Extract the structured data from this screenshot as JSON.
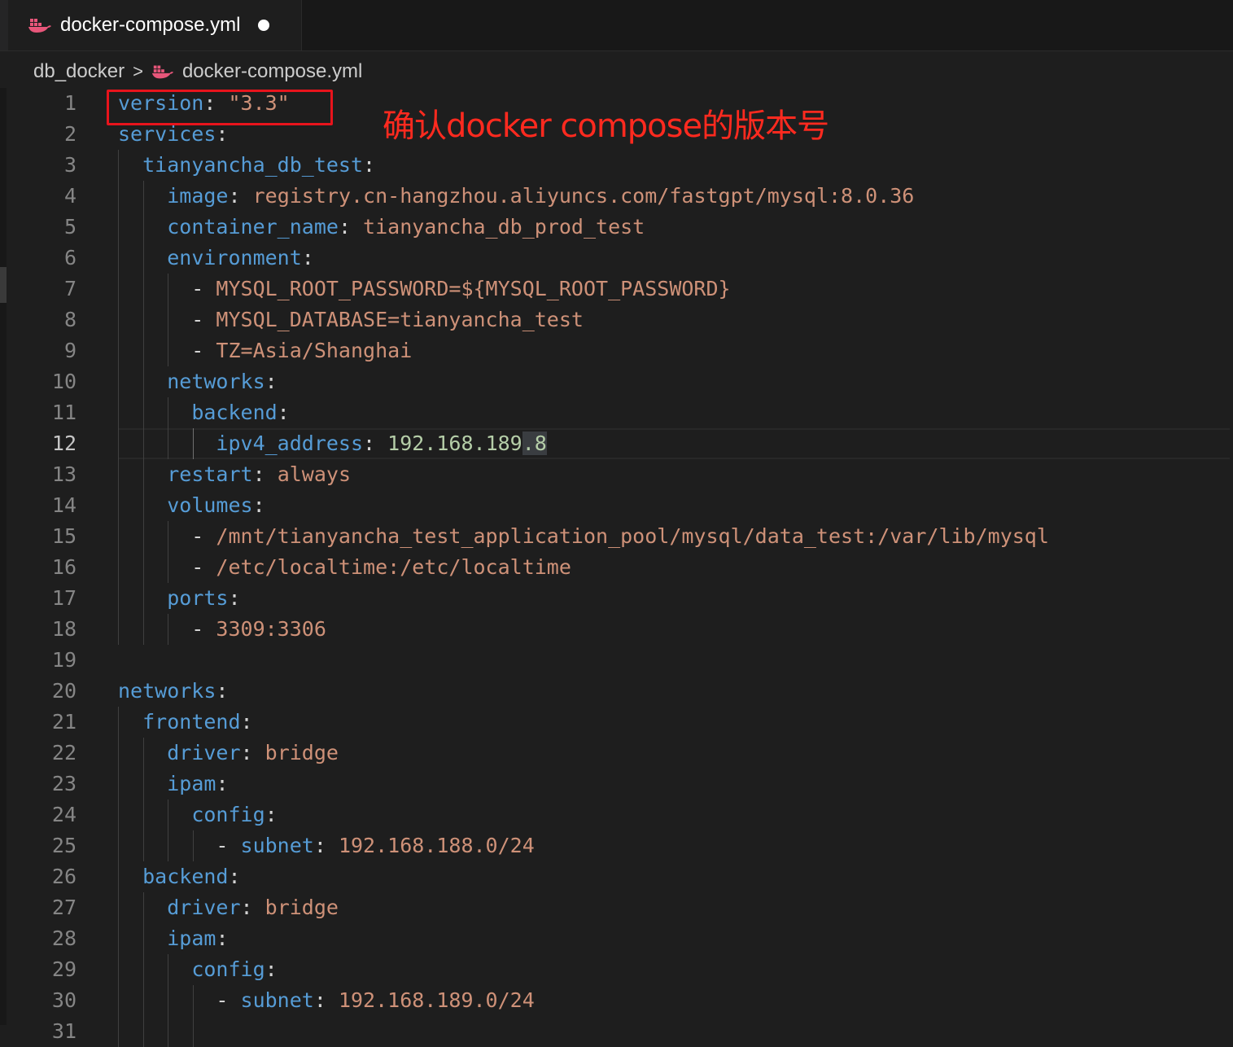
{
  "tab": {
    "title": "docker-compose.yml",
    "icon": "docker-icon",
    "dirty": true
  },
  "breadcrumb": {
    "folder": "db_docker",
    "separator": ">",
    "file": "docker-compose.yml"
  },
  "annotation": {
    "text": "确认docker compose的版本号",
    "color": "#ff2a1f"
  },
  "colors": {
    "key": "#569cd6",
    "string": "#ce9178",
    "number": "#b5cea8",
    "background": "#1e1e1e"
  },
  "active_line": 12,
  "lines": [
    {
      "n": "1",
      "tokens": [
        {
          "c": "k",
          "t": "version"
        },
        {
          "c": "p",
          "t": ": "
        },
        {
          "c": "s",
          "t": "\"3.3\""
        }
      ]
    },
    {
      "n": "2",
      "tokens": [
        {
          "c": "k",
          "t": "services"
        },
        {
          "c": "p",
          "t": ":"
        }
      ]
    },
    {
      "n": "3",
      "tokens": [
        {
          "c": "p",
          "t": "  "
        },
        {
          "c": "k",
          "t": "tianyancha_db_test"
        },
        {
          "c": "p",
          "t": ":"
        }
      ]
    },
    {
      "n": "4",
      "tokens": [
        {
          "c": "p",
          "t": "    "
        },
        {
          "c": "k",
          "t": "image"
        },
        {
          "c": "p",
          "t": ": "
        },
        {
          "c": "s",
          "t": "registry.cn-hangzhou.aliyuncs.com/fastgpt/mysql:8.0.36"
        }
      ]
    },
    {
      "n": "5",
      "tokens": [
        {
          "c": "p",
          "t": "    "
        },
        {
          "c": "k",
          "t": "container_name"
        },
        {
          "c": "p",
          "t": ": "
        },
        {
          "c": "s",
          "t": "tianyancha_db_prod_test"
        }
      ]
    },
    {
      "n": "6",
      "tokens": [
        {
          "c": "p",
          "t": "    "
        },
        {
          "c": "k",
          "t": "environment"
        },
        {
          "c": "p",
          "t": ":"
        }
      ]
    },
    {
      "n": "7",
      "tokens": [
        {
          "c": "p",
          "t": "      - "
        },
        {
          "c": "s",
          "t": "MYSQL_ROOT_PASSWORD=${MYSQL_ROOT_PASSWORD}"
        }
      ]
    },
    {
      "n": "8",
      "tokens": [
        {
          "c": "p",
          "t": "      - "
        },
        {
          "c": "s",
          "t": "MYSQL_DATABASE=tianyancha_test"
        }
      ]
    },
    {
      "n": "9",
      "tokens": [
        {
          "c": "p",
          "t": "      - "
        },
        {
          "c": "s",
          "t": "TZ=Asia/Shanghai"
        }
      ]
    },
    {
      "n": "10",
      "tokens": [
        {
          "c": "p",
          "t": "    "
        },
        {
          "c": "k",
          "t": "networks"
        },
        {
          "c": "p",
          "t": ":"
        }
      ]
    },
    {
      "n": "11",
      "tokens": [
        {
          "c": "p",
          "t": "      "
        },
        {
          "c": "k",
          "t": "backend"
        },
        {
          "c": "p",
          "t": ":"
        }
      ]
    },
    {
      "n": "12",
      "tokens": [
        {
          "c": "p",
          "t": "        "
        },
        {
          "c": "k",
          "t": "ipv4_address"
        },
        {
          "c": "p",
          "t": ": "
        },
        {
          "c": "n",
          "t": "192.168.189"
        },
        {
          "c": "n sel",
          "t": ".8"
        }
      ]
    },
    {
      "n": "13",
      "tokens": [
        {
          "c": "p",
          "t": "    "
        },
        {
          "c": "k",
          "t": "restart"
        },
        {
          "c": "p",
          "t": ": "
        },
        {
          "c": "s",
          "t": "always"
        }
      ]
    },
    {
      "n": "14",
      "tokens": [
        {
          "c": "p",
          "t": "    "
        },
        {
          "c": "k",
          "t": "volumes"
        },
        {
          "c": "p",
          "t": ":"
        }
      ]
    },
    {
      "n": "15",
      "tokens": [
        {
          "c": "p",
          "t": "      - "
        },
        {
          "c": "s",
          "t": "/mnt/tianyancha_test_application_pool/mysql/data_test:/var/lib/mysql"
        }
      ]
    },
    {
      "n": "16",
      "tokens": [
        {
          "c": "p",
          "t": "      - "
        },
        {
          "c": "s",
          "t": "/etc/localtime:/etc/localtime"
        }
      ]
    },
    {
      "n": "17",
      "tokens": [
        {
          "c": "p",
          "t": "    "
        },
        {
          "c": "k",
          "t": "ports"
        },
        {
          "c": "p",
          "t": ":"
        }
      ]
    },
    {
      "n": "18",
      "tokens": [
        {
          "c": "p",
          "t": "      - "
        },
        {
          "c": "s",
          "t": "3309:3306"
        }
      ]
    },
    {
      "n": "19",
      "tokens": []
    },
    {
      "n": "20",
      "tokens": [
        {
          "c": "k",
          "t": "networks"
        },
        {
          "c": "p",
          "t": ":"
        }
      ]
    },
    {
      "n": "21",
      "tokens": [
        {
          "c": "p",
          "t": "  "
        },
        {
          "c": "k",
          "t": "frontend"
        },
        {
          "c": "p",
          "t": ":"
        }
      ]
    },
    {
      "n": "22",
      "tokens": [
        {
          "c": "p",
          "t": "    "
        },
        {
          "c": "k",
          "t": "driver"
        },
        {
          "c": "p",
          "t": ": "
        },
        {
          "c": "s",
          "t": "bridge"
        }
      ]
    },
    {
      "n": "23",
      "tokens": [
        {
          "c": "p",
          "t": "    "
        },
        {
          "c": "k",
          "t": "ipam"
        },
        {
          "c": "p",
          "t": ":"
        }
      ]
    },
    {
      "n": "24",
      "tokens": [
        {
          "c": "p",
          "t": "      "
        },
        {
          "c": "k",
          "t": "config"
        },
        {
          "c": "p",
          "t": ":"
        }
      ]
    },
    {
      "n": "25",
      "tokens": [
        {
          "c": "p",
          "t": "        - "
        },
        {
          "c": "k",
          "t": "subnet"
        },
        {
          "c": "p",
          "t": ": "
        },
        {
          "c": "s",
          "t": "192.168.188.0/24"
        }
      ]
    },
    {
      "n": "26",
      "tokens": [
        {
          "c": "p",
          "t": "  "
        },
        {
          "c": "k",
          "t": "backend"
        },
        {
          "c": "p",
          "t": ":"
        }
      ]
    },
    {
      "n": "27",
      "tokens": [
        {
          "c": "p",
          "t": "    "
        },
        {
          "c": "k",
          "t": "driver"
        },
        {
          "c": "p",
          "t": ": "
        },
        {
          "c": "s",
          "t": "bridge"
        }
      ]
    },
    {
      "n": "28",
      "tokens": [
        {
          "c": "p",
          "t": "    "
        },
        {
          "c": "k",
          "t": "ipam"
        },
        {
          "c": "p",
          "t": ":"
        }
      ]
    },
    {
      "n": "29",
      "tokens": [
        {
          "c": "p",
          "t": "      "
        },
        {
          "c": "k",
          "t": "config"
        },
        {
          "c": "p",
          "t": ":"
        }
      ]
    },
    {
      "n": "30",
      "tokens": [
        {
          "c": "p",
          "t": "        - "
        },
        {
          "c": "k",
          "t": "subnet"
        },
        {
          "c": "p",
          "t": ": "
        },
        {
          "c": "s",
          "t": "192.168.189.0/24"
        }
      ]
    },
    {
      "n": "31",
      "tokens": []
    }
  ]
}
